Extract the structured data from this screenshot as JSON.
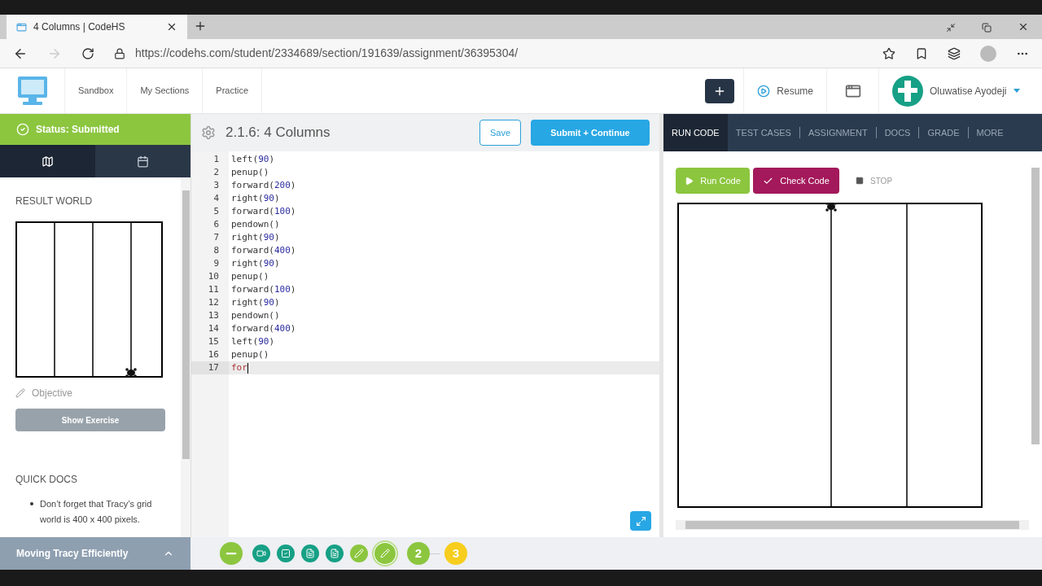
{
  "browser": {
    "tab_title": "4 Columns | CodeHS",
    "url": "https://codehs.com/student/2334689/section/191639/assignment/36395304/"
  },
  "nav": {
    "items": [
      "Sandbox",
      "My Sections",
      "Practice"
    ],
    "resume": "Resume",
    "user": "Oluwatise Ayodeji"
  },
  "sidebar": {
    "status": "Status: Submitted",
    "tabs": [
      {
        "kind": "map",
        "selected": true
      },
      {
        "kind": "calendar",
        "selected": false
      }
    ],
    "result_heading": "RESULT WORLD",
    "objective": "Objective",
    "show_exercise": "Show Exercise",
    "quick_docs": "QUICK DOCS",
    "doc_items": [
      "Don’t forget that Tracy’s grid world is 400 x 400 pixels."
    ],
    "footer": "Moving Tracy Efficiently"
  },
  "editor": {
    "title": "2.1.6: 4 Columns",
    "save": "Save",
    "submit": "Submit + Continue",
    "lines": [
      {
        "number": "1",
        "code": "left(90)",
        "current": false
      },
      {
        "number": "2",
        "code": "penup()",
        "current": false
      },
      {
        "number": "3",
        "code": "forward(200)",
        "current": false
      },
      {
        "number": "4",
        "code": "right(90)",
        "current": false
      },
      {
        "number": "5",
        "code": "forward(100)",
        "current": false
      },
      {
        "number": "6",
        "code": "pendown()",
        "current": false
      },
      {
        "number": "7",
        "code": "right(90)",
        "current": false
      },
      {
        "number": "8",
        "code": "forward(400)",
        "current": false
      },
      {
        "number": "9",
        "code": "right(90)",
        "current": false
      },
      {
        "number": "10",
        "code": "penup()",
        "current": false
      },
      {
        "number": "11",
        "code": "forward(100)",
        "current": false
      },
      {
        "number": "12",
        "code": "right(90)",
        "current": false
      },
      {
        "number": "13",
        "code": "pendown()",
        "current": false
      },
      {
        "number": "14",
        "code": "forward(400)",
        "current": false
      },
      {
        "number": "15",
        "code": "left(90)",
        "current": false
      },
      {
        "number": "16",
        "code": "penup()",
        "current": false
      },
      {
        "number": "17",
        "code": "for",
        "current": true
      }
    ]
  },
  "panel": {
    "tabs": [
      {
        "label": "RUN CODE",
        "selected": true
      },
      {
        "label": "TEST CASES",
        "selected": false
      },
      {
        "label": "ASSIGNMENT",
        "selected": false
      },
      {
        "label": "DOCS",
        "selected": false
      },
      {
        "label": "GRADE",
        "selected": false
      },
      {
        "label": "MORE",
        "selected": false
      }
    ],
    "run": "Run Code",
    "check": "Check Code",
    "stop": "STOP"
  },
  "progress": [
    {
      "kind": "minus"
    },
    {
      "kind": "video"
    },
    {
      "kind": "check"
    },
    {
      "kind": "doc"
    },
    {
      "kind": "doc"
    },
    {
      "kind": "pencil"
    },
    {
      "kind": "pencil-current"
    },
    {
      "kind": "number",
      "label": "2",
      "color": "#8cc63f"
    },
    {
      "kind": "number",
      "label": "3",
      "color": "#f7cd1e"
    }
  ]
}
